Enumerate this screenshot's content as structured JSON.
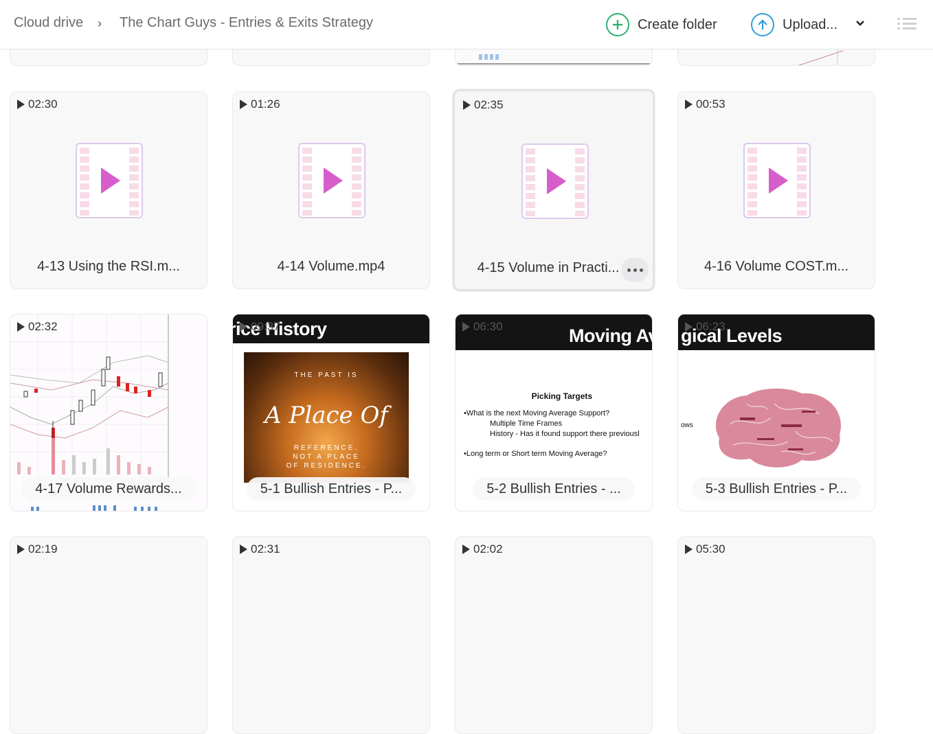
{
  "breadcrumb": {
    "root": "Cloud drive",
    "separator": "›",
    "current": "The Chart Guys - Entries & Exits Strategy"
  },
  "toolbar": {
    "create_folder_label": "Create folder",
    "upload_label": "Upload..."
  },
  "colors": {
    "create_accent": "#2bb070",
    "upload_accent": "#2f9fd8",
    "video_icon_accent": "#d65ecb"
  },
  "files": [
    {
      "duration": "02:30",
      "name": "4-13 Using the RSI.m...",
      "thumbnail": "video-file-icon"
    },
    {
      "duration": "01:26",
      "name": "4-14 Volume.mp4",
      "thumbnail": "video-file-icon"
    },
    {
      "duration": "02:35",
      "name": "4-15 Volume in Practi...",
      "thumbnail": "video-file-icon",
      "selected": true
    },
    {
      "duration": "00:53",
      "name": "4-16 Volume COST.m...",
      "thumbnail": "video-file-icon"
    },
    {
      "duration": "02:32",
      "name": "4-17 Volume Rewards...",
      "thumbnail": "stock-chart"
    },
    {
      "duration": "09:37",
      "name": "5-1 Bullish Entries - P...",
      "thumbnail": "slide-photo",
      "slide_title": "rice History",
      "photo_top": "THE PAST IS",
      "photo_main": "A Place Of",
      "photo_bottom1": "REFERENCE.",
      "photo_bottom2": "NOT A PLACE",
      "photo_bottom3": "OF RESIDENCE."
    },
    {
      "duration": "06:30",
      "name": "5-2 Bullish Entries - ...",
      "thumbnail": "slide-text",
      "slide_title": "Moving Av",
      "slide_heading": "Picking Targets",
      "slide_line1": "•What is the next Moving Average Support?",
      "slide_line2": "Multiple Time Frames",
      "slide_line3": "History - Has it found support there previousl",
      "slide_line4": "•Long term or Short term Moving Average?"
    },
    {
      "duration": "06:23",
      "name": "5-3 Bullish Entries - P...",
      "thumbnail": "slide-brain",
      "slide_title": "gical Levels",
      "slide_side": "ows"
    },
    {
      "duration": "02:19"
    },
    {
      "duration": "02:31"
    },
    {
      "duration": "02:02"
    },
    {
      "duration": "05:30"
    }
  ]
}
